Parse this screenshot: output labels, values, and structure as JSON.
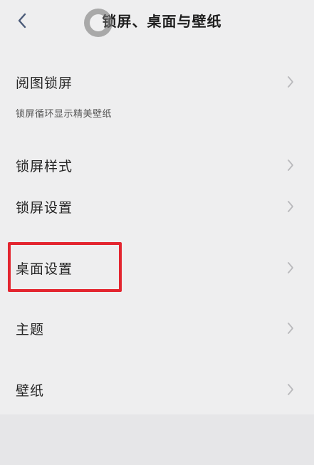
{
  "header": {
    "title": "锁屏、桌面与壁纸",
    "back_icon": "chevron-left-icon"
  },
  "items": [
    {
      "label": "阅图锁屏",
      "subtitle": "锁屏循环显示精美壁纸"
    },
    {
      "label": "锁屏样式"
    },
    {
      "label": "锁屏设置"
    },
    {
      "label": "桌面设置",
      "highlighted": true
    },
    {
      "label": "主题"
    },
    {
      "label": "壁纸"
    }
  ],
  "colors": {
    "background": "#eeeeef",
    "highlight": "#e3252f",
    "chevron": "#b9b9bc"
  }
}
